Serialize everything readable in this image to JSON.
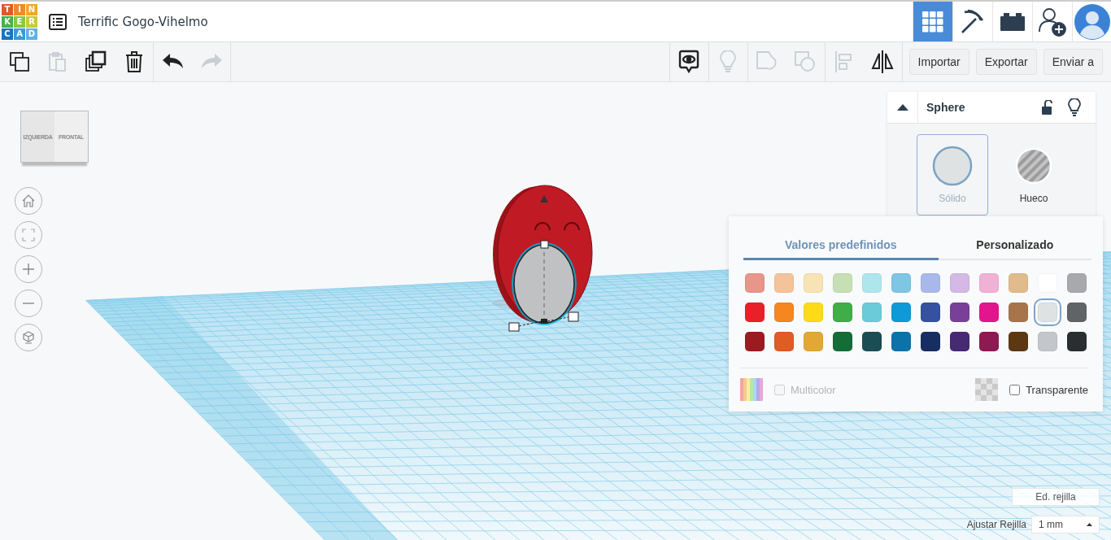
{
  "header": {
    "logo": [
      {
        "letter": "T",
        "color": "#e4572e"
      },
      {
        "letter": "I",
        "color": "#f08a24"
      },
      {
        "letter": "N",
        "color": "#f4a623"
      },
      {
        "letter": "K",
        "color": "#4cae4c"
      },
      {
        "letter": "E",
        "color": "#8cc63f"
      },
      {
        "letter": "R",
        "color": "#c8c93a"
      },
      {
        "letter": "C",
        "color": "#1c75bc"
      },
      {
        "letter": "A",
        "color": "#3a9ad9"
      },
      {
        "letter": "D",
        "color": "#5fb0e5"
      }
    ],
    "title": "Terrific Gogo-Vihelmo",
    "nav": [
      {
        "kind": "grid",
        "selected": true
      },
      {
        "kind": "pickaxe",
        "selected": false
      },
      {
        "kind": "brick",
        "selected": false
      },
      {
        "kind": "add-user",
        "selected": false
      }
    ]
  },
  "toolbar": {
    "left": [
      {
        "kind": "copy",
        "disabled": false
      },
      {
        "kind": "paste",
        "disabled": true
      },
      {
        "kind": "duplicate",
        "disabled": false
      },
      {
        "kind": "delete",
        "disabled": false
      },
      {
        "kind": "undo",
        "disabled": false
      },
      {
        "kind": "redo",
        "disabled": true
      }
    ],
    "right": [
      {
        "kind": "note",
        "disabled": false
      },
      {
        "kind": "bulb",
        "disabled": true
      },
      {
        "kind": "group",
        "disabled": true
      },
      {
        "kind": "ungroup",
        "disabled": true
      },
      {
        "kind": "align",
        "disabled": true
      },
      {
        "kind": "mirror",
        "disabled": false
      }
    ],
    "buttons": [
      "Importar",
      "Exportar",
      "Enviar a"
    ]
  },
  "view_cube": {
    "left_face": "IZQUIERDA",
    "front_face": "FRONTAL"
  },
  "view_controls": [
    {
      "kind": "home"
    },
    {
      "kind": "fit"
    },
    {
      "kind": "zoom-in"
    },
    {
      "kind": "zoom-out"
    },
    {
      "kind": "ortho"
    }
  ],
  "inspector": {
    "title": "Sphere",
    "modes": [
      {
        "kind": "solid",
        "label": "Sólido",
        "selected": true
      },
      {
        "kind": "hole",
        "label": "Hueco",
        "selected": false
      }
    ]
  },
  "color_picker": {
    "tabs": [
      {
        "label": "Valores predefinidos",
        "selected": true
      },
      {
        "label": "Personalizado",
        "selected": false
      }
    ],
    "swatches": [
      {
        "color": "#e8958a",
        "selected": false
      },
      {
        "color": "#f5c39a",
        "selected": false
      },
      {
        "color": "#f7e3b3",
        "selected": false
      },
      {
        "color": "#c6e0b4",
        "selected": false
      },
      {
        "color": "#aee6ee",
        "selected": false
      },
      {
        "color": "#7ec6e4",
        "selected": false
      },
      {
        "color": "#a9b8ea",
        "selected": false
      },
      {
        "color": "#d4b8e6",
        "selected": false
      },
      {
        "color": "#f0b1d4",
        "selected": false
      },
      {
        "color": "#e2bb8c",
        "selected": false
      },
      {
        "color": "#ffffff",
        "selected": false
      },
      {
        "color": "#a7a9ac",
        "selected": false
      },
      {
        "color": "#e8202a",
        "selected": false
      },
      {
        "color": "#f6861f",
        "selected": false
      },
      {
        "color": "#fddc15",
        "selected": false
      },
      {
        "color": "#3fae49",
        "selected": false
      },
      {
        "color": "#6ccbd8",
        "selected": false
      },
      {
        "color": "#0e9ad7",
        "selected": false
      },
      {
        "color": "#35519f",
        "selected": false
      },
      {
        "color": "#7a3f98",
        "selected": false
      },
      {
        "color": "#e2168c",
        "selected": false
      },
      {
        "color": "#a8754a",
        "selected": false
      },
      {
        "color": "#dfe2e3",
        "selected": true
      },
      {
        "color": "#606467",
        "selected": false
      },
      {
        "color": "#9b1c20",
        "selected": false
      },
      {
        "color": "#e15b24",
        "selected": false
      },
      {
        "color": "#e1a934",
        "selected": false
      },
      {
        "color": "#146d36",
        "selected": false
      },
      {
        "color": "#1b4d55",
        "selected": false
      },
      {
        "color": "#0b73a8",
        "selected": false
      },
      {
        "color": "#172e62",
        "selected": false
      },
      {
        "color": "#482973",
        "selected": false
      },
      {
        "color": "#8e1a52",
        "selected": false
      },
      {
        "color": "#5c3813",
        "selected": false
      },
      {
        "color": "#c3c6ca",
        "selected": false
      },
      {
        "color": "#2a2e31",
        "selected": false
      }
    ],
    "multicolor": {
      "label": "Multicolor",
      "checked": false,
      "disabled": true
    },
    "transparent": {
      "label": "Transparente",
      "checked": false
    }
  },
  "grid_controls": {
    "edit_button": "Ed. rejilla",
    "snap_label": "Ajustar Rejilla",
    "snap_value": "1 mm"
  }
}
